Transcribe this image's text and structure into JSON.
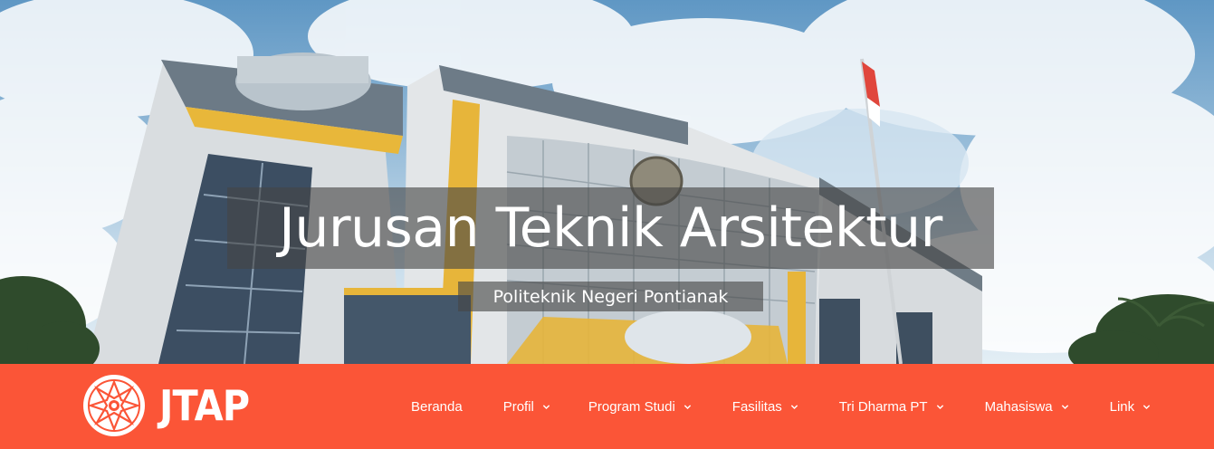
{
  "hero": {
    "title": "Jurusan Teknik Arsitektur",
    "subtitle": "Politeknik Negeri Pontianak",
    "background_image": "campus-building-photo"
  },
  "navbar": {
    "background_color": "#fb5537",
    "brand": {
      "logo_icon": "jtap-logo-icon",
      "text": "JTAP"
    },
    "menu": [
      {
        "label": "Beranda",
        "has_dropdown": false
      },
      {
        "label": "Profil",
        "has_dropdown": true
      },
      {
        "label": "Program Studi",
        "has_dropdown": true
      },
      {
        "label": "Fasilitas",
        "has_dropdown": true
      },
      {
        "label": "Tri Dharma PT",
        "has_dropdown": true
      },
      {
        "label": "Mahasiswa",
        "has_dropdown": true
      },
      {
        "label": "Link",
        "has_dropdown": true
      }
    ]
  }
}
